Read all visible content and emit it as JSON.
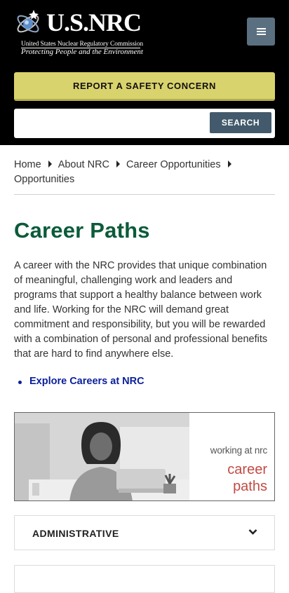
{
  "header": {
    "logo_title": "U.S.NRC",
    "logo_subtitle": "United States Nuclear Regulatory Commission",
    "logo_tagline": "Protecting People and the Environment",
    "menu_icon": "hamburger-icon",
    "report_label": "REPORT A SAFETY CONCERN",
    "search_placeholder": "",
    "search_label": "SEARCH"
  },
  "breadcrumb": {
    "items": [
      "Home",
      "About NRC",
      "Career Opportunities",
      "Opportunities"
    ]
  },
  "main": {
    "title": "Career Paths",
    "intro": "A career with the NRC provides that unique combination of meaningful, challenging work and leaders and programs that support a healthy balance between work and life. Working for the NRC will demand great commitment and responsibility, but you will be rewarded with a combination of personal and professional benefits that are hard to find anywhere else.",
    "links": [
      "Explore Careers at NRC"
    ]
  },
  "banner": {
    "small_text": "working at nrc",
    "big_line1": "career",
    "big_line2": "paths"
  },
  "accordion": {
    "items": [
      "ADMINISTRATIVE"
    ]
  },
  "colors": {
    "header_bg": "#000000",
    "report_bg": "#d9d36d",
    "search_btn": "#425a6b",
    "title_green": "#0b5b3a",
    "link_blue": "#0a1f9b",
    "banner_red": "#c24a44"
  }
}
